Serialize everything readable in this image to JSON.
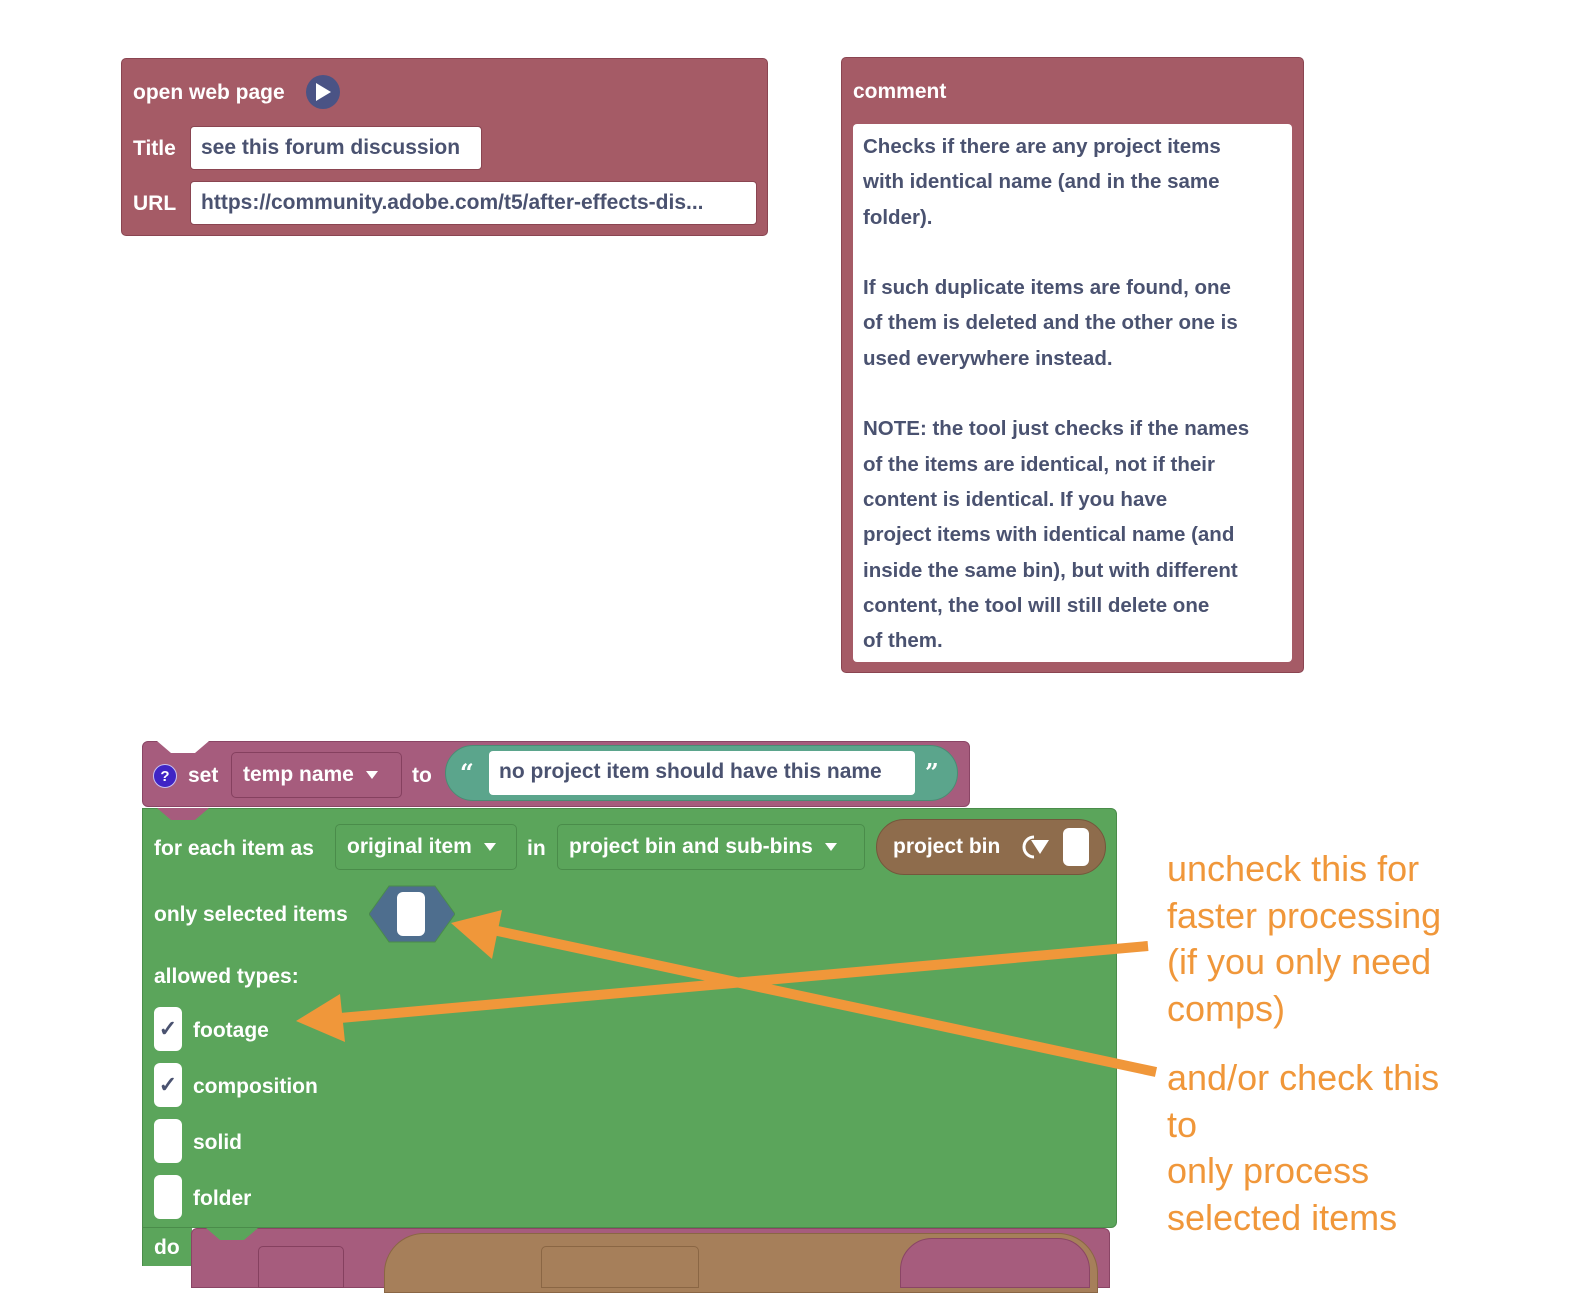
{
  "open_web_page": {
    "header": "open web page",
    "title_label": "Title",
    "title_value": "see this forum discussion",
    "url_label": "URL",
    "url_value": "https://community.adobe.com/t5/after-effects-dis..."
  },
  "comment": {
    "header": "comment",
    "text": "Checks if there are any project items\nwith identical name (and in the same\nfolder).\n\nIf such duplicate items are found, one\nof them is deleted and the other one is\nused everywhere instead.\n\nNOTE: the tool just checks if the names\nof the items are identical, not if their\ncontent is identical. If you have\nproject items with identical name (and\ninside the same bin), but with different\ncontent, the tool will still delete one\nof them."
  },
  "set_block": {
    "help_icon": "?",
    "set_label": "set",
    "variable": "temp name",
    "to_label": "to",
    "open_quote": "“",
    "value": "no project item should have this name",
    "close_quote": "”"
  },
  "for_each": {
    "label": "for each item as",
    "variable": "original item",
    "in_label": "in",
    "scope": "project bin and sub-bins",
    "bin_block_label": "project bin",
    "only_selected_label": "only selected items",
    "only_selected_checked": false,
    "allowed_types_label": "allowed types:",
    "types": [
      {
        "label": "footage",
        "checked": true
      },
      {
        "label": "composition",
        "checked": true
      },
      {
        "label": "solid",
        "checked": false
      },
      {
        "label": "folder",
        "checked": false
      }
    ],
    "do_label": "do"
  },
  "check_mark": "✓",
  "annotations": {
    "note1": "uncheck this for\nfaster processing\n(if you only need\ncomps)",
    "note2": "and/or check this\nto\nonly process\nselected items",
    "color": "#f0973a"
  }
}
